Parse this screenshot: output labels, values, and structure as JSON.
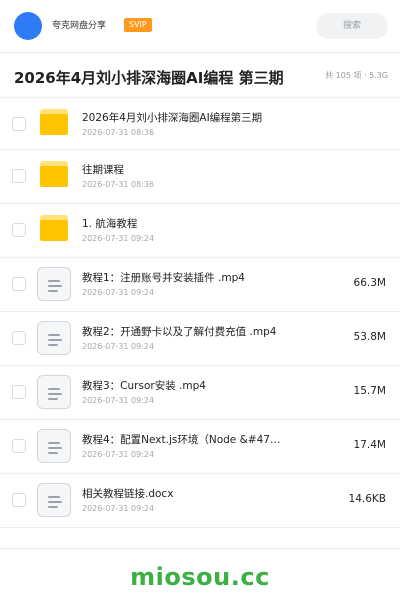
{
  "topbar": {
    "brand": "夸克网盘分享",
    "badge": "SVIP",
    "search_placeholder": "搜索"
  },
  "header": {
    "title": "2026年4月刘小排深海圈AI编程 第三期",
    "summary": "共 105 项 · 5.3G"
  },
  "items": [
    {
      "type": "folder",
      "name": "2026年4月刘小排深海圈AI编程第三期",
      "date": "2026-07-31 08:36",
      "size": ""
    },
    {
      "type": "folder",
      "name": "往期课程",
      "date": "2026-07-31 08:36",
      "size": ""
    },
    {
      "type": "folder",
      "name": "1. 航海教程",
      "date": "2026-07-31 09:24",
      "size": ""
    },
    {
      "type": "file",
      "name": "教程1：注册账号并安装插件 .mp4",
      "date": "2026-07-31 09:24",
      "size": "66.3M"
    },
    {
      "type": "file",
      "name": "教程2：开通野卡以及了解付费充值 .mp4",
      "date": "2026-07-31 09:24",
      "size": "53.8M"
    },
    {
      "type": "file",
      "name": "教程3：Cursor安装 .mp4",
      "date": "2026-07-31 09:24",
      "size": "15.7M"
    },
    {
      "type": "file",
      "name": "教程4：配置Next.js环境（Node &#47…",
      "date": "2026-07-31 09:24",
      "size": "17.4M"
    },
    {
      "type": "file",
      "name": "相关教程链接.docx",
      "date": "2026-07-31 09:24",
      "size": "14.6KB"
    }
  ],
  "footer": {
    "watermark": "miosou.cc"
  },
  "colors": {
    "avatar": "#2f7bf5",
    "badge": "#ff9a1f",
    "folder": "#ffc400",
    "watermark": "#3cb043"
  },
  "icons": {
    "folder": "folder-icon",
    "file": "document-icon"
  }
}
